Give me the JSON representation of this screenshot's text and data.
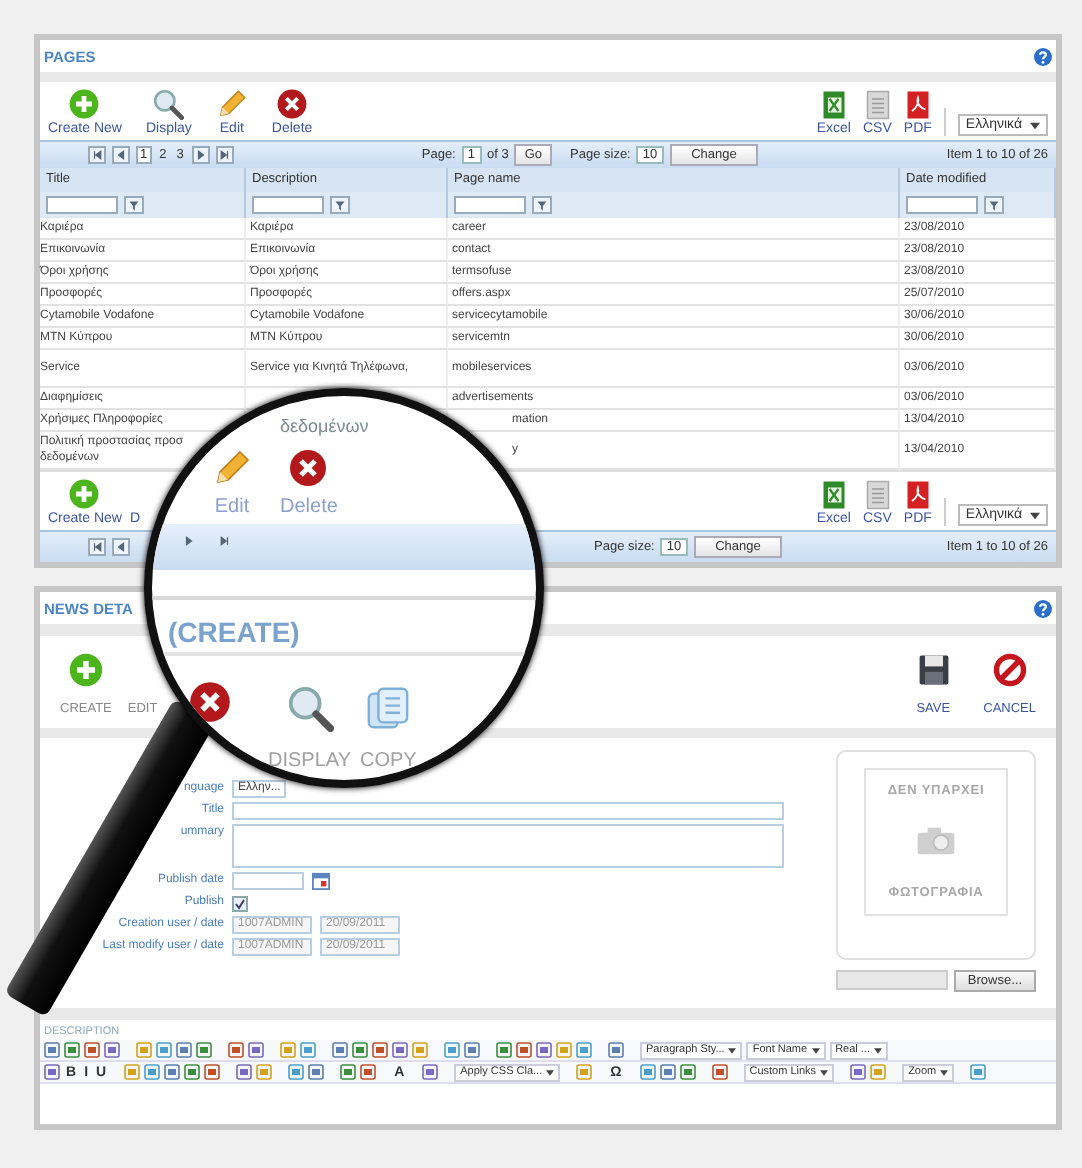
{
  "pages_panel": {
    "title": "PAGES",
    "toolbar": [
      {
        "kind": "create",
        "label": "Create New"
      },
      {
        "kind": "display",
        "label": "Display"
      },
      {
        "kind": "edit",
        "label": "Edit"
      },
      {
        "kind": "delete",
        "label": "Delete"
      }
    ],
    "exports": [
      {
        "kind": "excel",
        "label": "Excel"
      },
      {
        "kind": "csv",
        "label": "CSV"
      },
      {
        "kind": "pdf",
        "label": "PDF"
      }
    ],
    "language": "Ελληνικά",
    "pager": {
      "pages": [
        {
          "label": "1",
          "selected": true
        },
        {
          "label": "2",
          "selected": false
        },
        {
          "label": "3",
          "selected": false
        }
      ],
      "page_label": "Page:",
      "page_value": "1",
      "page_of": "of 3",
      "go": "Go",
      "size_label": "Page size:",
      "size_value": "10",
      "change": "Change",
      "info": "Item 1 to 10 of 26"
    },
    "table": {
      "columns": [
        "Title",
        "Description",
        "Page name",
        "Date modified"
      ],
      "rows": [
        {
          "title": "Καριέρα",
          "description": "Καριέρα",
          "page_name": "career",
          "date_modified": "23/08/2010"
        },
        {
          "title": "Επικοινωνία",
          "description": "Επικοινωνία",
          "page_name": "contact",
          "date_modified": "23/08/2010"
        },
        {
          "title": "Όροι χρήσης",
          "description": "Όροι χρήσης",
          "page_name": "termsofuse",
          "date_modified": "23/08/2010"
        },
        {
          "title": "Προσφορές",
          "description": "Προσφορές",
          "page_name": "offers.aspx",
          "date_modified": "25/07/2010"
        },
        {
          "title": "Cytamobile Vodafone",
          "description": "Cytamobile Vodafone",
          "page_name": "servicecytamobile",
          "date_modified": "30/06/2010"
        },
        {
          "title": "MTN Κύπρου",
          "description": "MTN Κύπρου",
          "page_name": "servicemtn",
          "date_modified": "30/06/2010"
        },
        {
          "title": "Service",
          "description": "Service για Κινητά Τηλέφωνα,",
          "page_name": "mobileservices",
          "date_modified": "03/06/2010",
          "tall": true
        },
        {
          "title": "Διαφημίσεις",
          "page_name": "advertisements",
          "date_modified": "03/06/2010"
        },
        {
          "title": "Χρήσιμες Πληροφορίες",
          "page_name": "mation",
          "page_name_cut": true,
          "date_modified": "13/04/2010"
        },
        {
          "title": "Πολιτική προστασίας προσ",
          "title_continued": "δεδομένων",
          "page_name": "y",
          "page_name_cut": true,
          "date_modified": "13/04/2010",
          "tall": true
        }
      ]
    },
    "bottom_toolbar": [
      {
        "kind": "create",
        "label": "Create New"
      },
      {
        "label": "D"
      }
    ],
    "bottom_exports": [
      {
        "kind": "excel",
        "label": "Excel"
      },
      {
        "kind": "csv",
        "label": "CSV"
      },
      {
        "kind": "pdf",
        "label": "PDF"
      }
    ],
    "bottom_language": "Ελληνικά",
    "bottom_pager": {
      "size_label": "Page size:",
      "size_value": "10",
      "change": "Change",
      "info": "Item 1 to 10 of 26"
    }
  },
  "magnifier": {
    "table_cell": "δεδομένων",
    "buttons": [
      {
        "kind": "edit",
        "label": "Edit"
      },
      {
        "kind": "delete",
        "label": "Delete"
      }
    ],
    "title": "(CREATE)",
    "toolbar": [
      {
        "kind": "display",
        "label": "DISPLAY"
      },
      {
        "kind": "copy",
        "label": "COPY"
      }
    ]
  },
  "news_panel": {
    "title": "NEWS DETA",
    "toolbar": [
      {
        "kind": "create",
        "label": "CREATE"
      },
      {
        "label": "EDIT"
      }
    ],
    "actions": [
      {
        "kind": "save",
        "label": "SAVE"
      },
      {
        "kind": "cancel",
        "label": "CANCEL"
      }
    ],
    "form": [
      {
        "kind": "select",
        "label": "nguage",
        "value": "Ελλην..."
      },
      {
        "kind": "text",
        "label": "Title"
      },
      {
        "kind": "textarea",
        "label": "ummary"
      },
      {
        "kind": "date",
        "label": "Publish date"
      },
      {
        "kind": "checkbox",
        "label": "Publish",
        "checked": true
      },
      {
        "kind": "pair",
        "label": "Creation user / date",
        "values": [
          "1007ADMIN",
          "20/09/2011"
        ]
      },
      {
        "kind": "pair",
        "label": "Last modify user / date",
        "values": [
          "1007ADMIN",
          "20/09/2011"
        ]
      }
    ],
    "photo": {
      "line_1": "ΔΕΝ ΥΠΑΡΧΕΙ",
      "line_2": "ΦΩΤΟΓΡΑΦΙΑ"
    },
    "browse": "Browse...",
    "description_label": "DESCRIPTION",
    "editor_rows": [
      [
        {
          "kind": "dropdown",
          "text": "Paragraph Sty..."
        },
        {
          "kind": "dropdown",
          "text": "Font Name"
        },
        {
          "kind": "dropdown",
          "text": "Real ..."
        }
      ],
      [
        {
          "kind": "glyph",
          "text": "B"
        },
        {
          "kind": "glyph",
          "text": "I"
        },
        {
          "kind": "glyph",
          "text": "U"
        },
        {
          "kind": "glyph",
          "text": "A"
        },
        {
          "kind": "dropdown",
          "text": "Apply CSS Cla..."
        },
        {
          "kind": "glyph",
          "text": "Ω"
        },
        {
          "kind": "dropdown",
          "text": "Custom Links"
        },
        {
          "kind": "dropdown",
          "text": "Zoom"
        }
      ]
    ]
  }
}
